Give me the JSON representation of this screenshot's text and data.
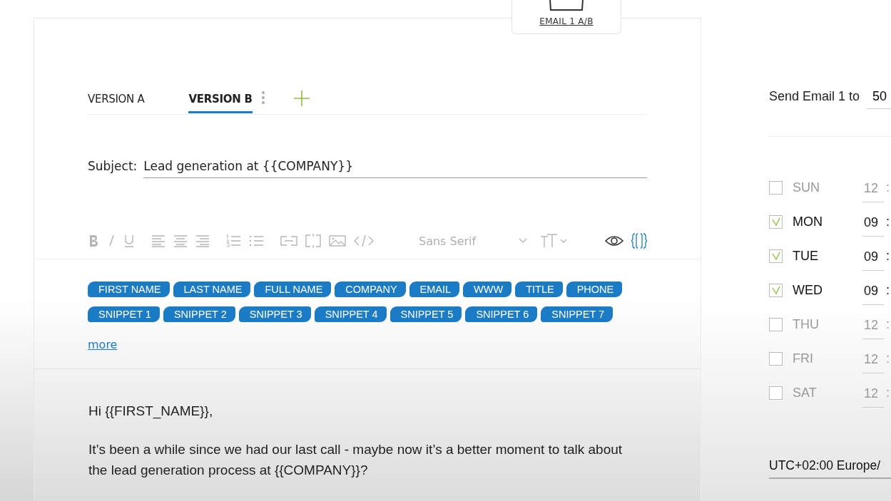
{
  "top_tab": {
    "label": "EMAIL 1  A/B"
  },
  "version_tabs": [
    {
      "label": "VERSION A",
      "selected": false
    },
    {
      "label": "VERSION B",
      "selected": true
    }
  ],
  "subject": {
    "label": "Subject:",
    "value": "Lead generation at {{COMPANY}}"
  },
  "toolbar": {
    "font": "Sans Serif",
    "variables_open": true
  },
  "variables": [
    {
      "label": "FIRST NAME"
    },
    {
      "label": "LAST NAME"
    },
    {
      "label": "FULL NAME"
    },
    {
      "label": "COMPANY"
    },
    {
      "label": "EMAIL"
    },
    {
      "label": "WWW"
    },
    {
      "label": "TITLE"
    },
    {
      "label": "PHONE"
    },
    {
      "label": "SNIPPET 1"
    },
    {
      "label": "SNIPPET 2"
    },
    {
      "label": "SNIPPET 3"
    },
    {
      "label": "SNIPPET 4"
    },
    {
      "label": "SNIPPET 5"
    },
    {
      "label": "SNIPPET 6"
    },
    {
      "label": "SNIPPET 7"
    }
  ],
  "more_link": "more",
  "body": [
    "Hi {{FIRST_NAME}},",
    "It’s been a while since we had our last call - maybe now it’s a better moment to talk about the lead generation process at {{COMPANY}}?"
  ],
  "schedule": {
    "send_label": "Send Email 1 to",
    "send_value": "50",
    "days": [
      {
        "label": "SUN",
        "checked": false,
        "hour": "12"
      },
      {
        "label": "MON",
        "checked": true,
        "hour": "09"
      },
      {
        "label": "TUE",
        "checked": true,
        "hour": "09"
      },
      {
        "label": "WED",
        "checked": true,
        "hour": "09"
      },
      {
        "label": "THU",
        "checked": false,
        "hour": "12"
      },
      {
        "label": "FRI",
        "checked": false,
        "hour": "12"
      },
      {
        "label": "SAT",
        "checked": false,
        "hour": "12"
      }
    ],
    "separator": ":",
    "timezone": "UTC+02:00 Europe/"
  }
}
